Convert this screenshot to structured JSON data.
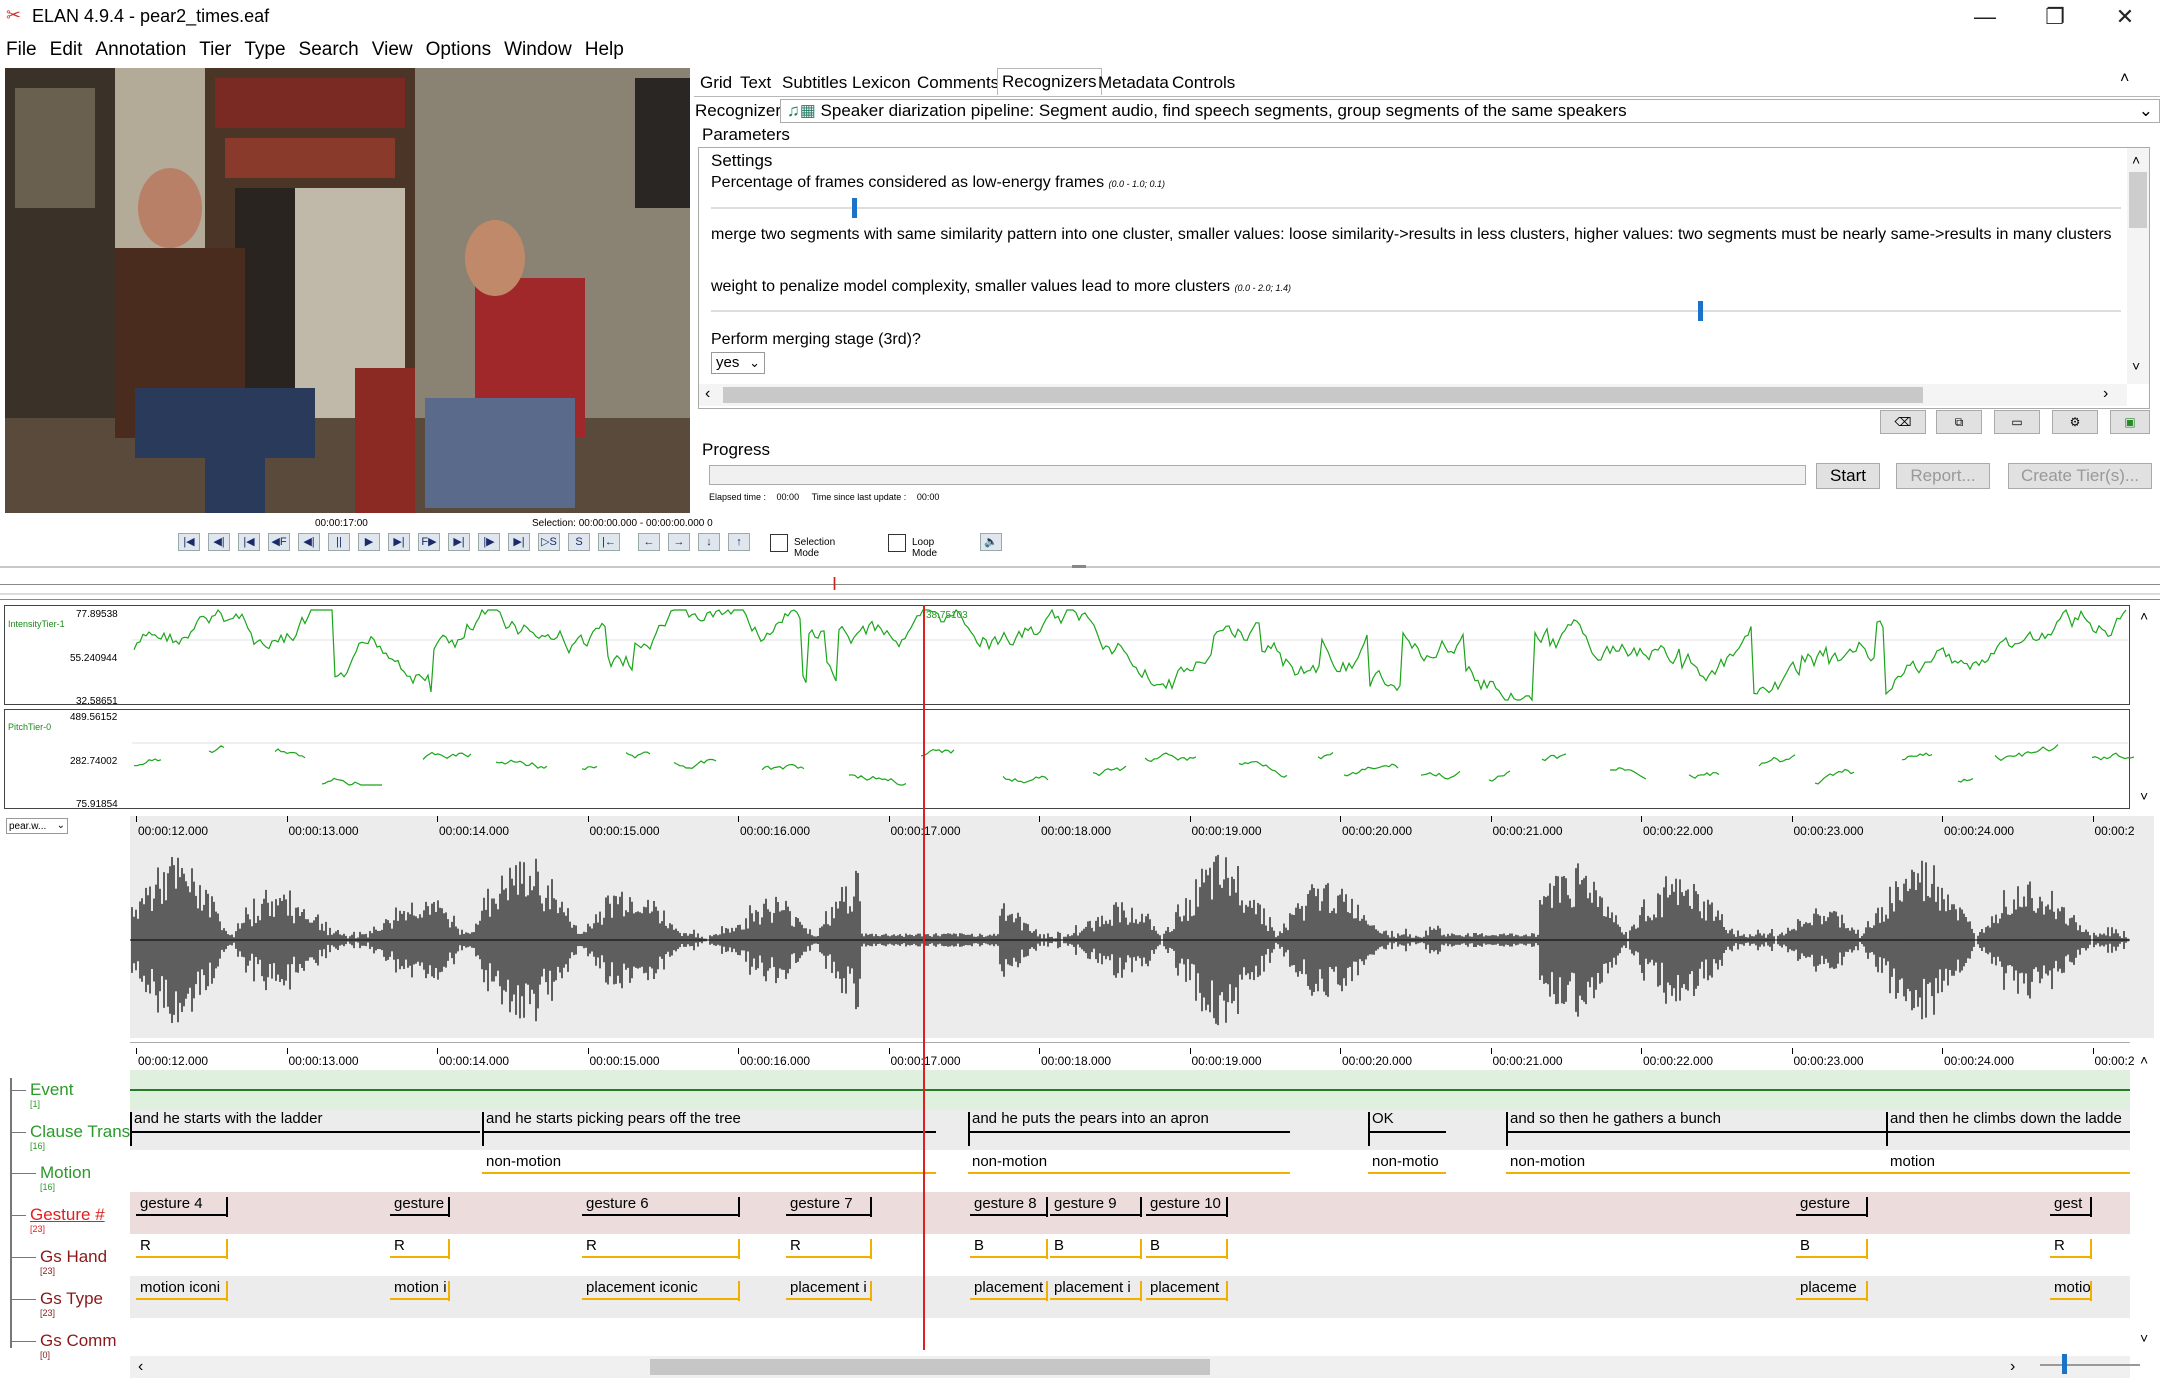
{
  "window": {
    "title": "ELAN 4.9.4 - pear2_times.eaf",
    "minimize": "—",
    "restore": "❐",
    "close": "✕"
  },
  "menu": [
    "File",
    "Edit",
    "Annotation",
    "Tier",
    "Type",
    "Search",
    "View",
    "Options",
    "Window",
    "Help"
  ],
  "player": {
    "current_time": "00:00:17:00",
    "selection": "Selection: 00:00:00.000 - 00:00:00.000  0",
    "selection_mode": "Selection Mode",
    "loop_mode": "Loop Mode"
  },
  "tabs": [
    "Grid",
    "Text",
    "Subtitles",
    "Lexicon",
    "Comments",
    "Recognizers",
    "Metadata",
    "Controls"
  ],
  "active_tab": "Recognizers",
  "recognizer": {
    "label": "Recognizer:",
    "value": "Speaker diarization pipeline: Segment audio, find speech segments, group segments of the same speakers",
    "parameters_label": "Parameters",
    "settings_label": "Settings",
    "params": [
      {
        "label": "Percentage of frames considered as low-energy frames",
        "range": "(0.0 - 1.0; 0.1)",
        "level": 0.1
      },
      {
        "label": "merge two segments with same similarity pattern into one cluster, smaller values: loose similarity->results in less clusters, higher values: two segments must be nearly same->results in many clusters"
      },
      {
        "label": "weight to penalize model complexity, smaller values lead to more clusters",
        "range": "(0.0 - 2.0; 1.4)",
        "level": 0.7
      },
      {
        "label": "Perform merging stage (3rd)?",
        "select": "yes"
      }
    ]
  },
  "progress": {
    "label": "Progress",
    "elapsed_label": "Elapsed time :",
    "elapsed_value": "00:00",
    "since_label": "Time since last update :",
    "since_value": "00:00",
    "start": "Start",
    "report": "Report...",
    "create": "Create Tier(s)..."
  },
  "tracks": {
    "intensity": {
      "name": "IntensityTier-1",
      "max": "77.89538",
      "mid": "55.240944",
      "min": "32.58651",
      "cursor_value": "38.75103"
    },
    "pitch": {
      "name": "PitchTier-0",
      "max": "489.56152",
      "mid": "282.74002",
      "min": "75.91854"
    }
  },
  "waveform": {
    "selector": "pear.w..."
  },
  "ruler_ticks": [
    "00:00:12.000",
    "00:00:13.000",
    "00:00:14.000",
    "00:00:15.000",
    "00:00:16.000",
    "00:00:17.000",
    "00:00:18.000",
    "00:00:19.000",
    "00:00:20.000",
    "00:00:21.000",
    "00:00:22.000",
    "00:00:23.000",
    "00:00:24.000",
    "00:00:2"
  ],
  "tiers": [
    {
      "name": "Event",
      "count": "[1]",
      "color": "#2a9a2a"
    },
    {
      "name": "Clause Trans",
      "count": "[16]",
      "color": "#2a9a2a"
    },
    {
      "name": "Motion",
      "count": "[16]",
      "color": "#2a9a2a"
    },
    {
      "name": "Gesture #",
      "count": "[23]",
      "color": "#e02020"
    },
    {
      "name": "Gs Hand",
      "count": "[23]",
      "color": "#8a1a1a"
    },
    {
      "name": "Gs Type",
      "count": "[23]",
      "color": "#8a1a1a"
    },
    {
      "name": "Gs Comm",
      "count": "[0]",
      "color": "#8a1a1a"
    }
  ],
  "annotations": {
    "clause": [
      "and he starts with the ladder",
      "and he starts picking pears off the tree",
      "and he puts the pears into an apron",
      "OK",
      "and so then he gathers a bunch",
      "and then he climbs down the ladde"
    ],
    "motion": [
      "non-motion",
      "non-motion",
      "non-motio",
      "non-motion",
      "motion"
    ],
    "gesture": [
      "gesture 4",
      "gesture",
      "gesture 6",
      "gesture 7",
      "gesture 8",
      "gesture 9",
      "gesture 10",
      "gesture",
      "gest"
    ],
    "hand": [
      "R",
      "R",
      "R",
      "R",
      "B",
      "B",
      "B",
      "B",
      "R"
    ],
    "type": [
      "motion iconi",
      "motion i",
      "placement iconic",
      "placement i",
      "placement",
      "placement i",
      "placement",
      "placeme",
      "motio"
    ]
  }
}
